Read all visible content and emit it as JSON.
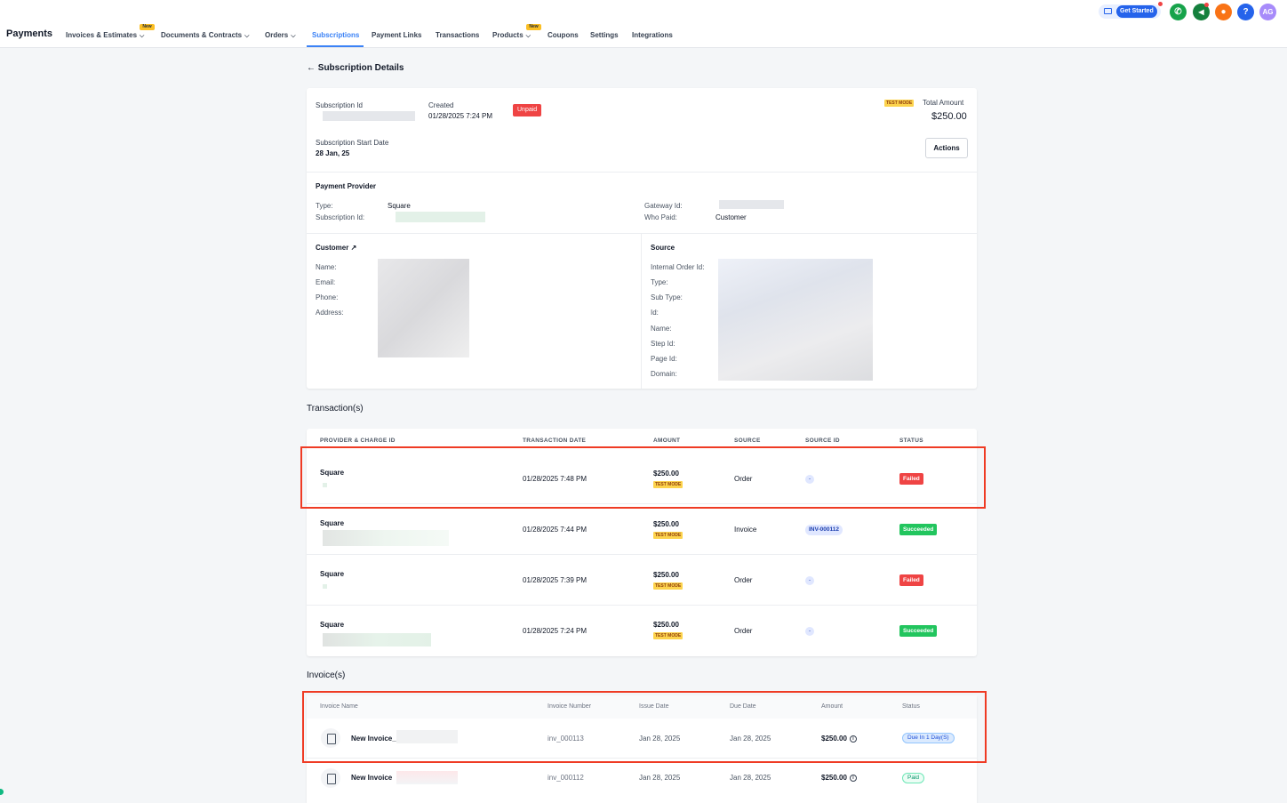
{
  "app": {
    "title": "Payments"
  },
  "nav": {
    "invoices": "Invoices & Estimates",
    "documents": "Documents & Contracts",
    "orders": "Orders",
    "subscriptions": "Subscriptions",
    "payment_links": "Payment Links",
    "transactions": "Transactions",
    "products": "Products",
    "coupons": "Coupons",
    "settings": "Settings",
    "integrations": "Integrations",
    "new_badge": "New"
  },
  "header_actions": {
    "get_started": "Get Started",
    "help": "?",
    "avatar": "AG"
  },
  "page": {
    "back_title": "Subscription Details"
  },
  "summary": {
    "subscription_id_label": "Subscription Id",
    "created_label": "Created",
    "created_value": "01/28/2025 7:24 PM",
    "status": "Unpaid",
    "test_mode": "TEST MODE",
    "total_label": "Total Amount",
    "total_value": "$250.00",
    "start_label": "Subscription Start Date",
    "start_value": "28 Jan, 25",
    "actions_button": "Actions"
  },
  "provider": {
    "title": "Payment Provider",
    "type_label": "Type:",
    "type_value": "Square",
    "sub_id_label": "Subscription Id:",
    "gateway_label": "Gateway Id:",
    "who_paid_label": "Who Paid:",
    "who_paid_value": "Customer"
  },
  "customer": {
    "title": "Customer",
    "name_label": "Name:",
    "email_label": "Email:",
    "phone_label": "Phone:",
    "address_label": "Address:"
  },
  "source": {
    "title": "Source",
    "internal_label": "Internal Order Id:",
    "type_label": "Type:",
    "subtype_label": "Sub Type:",
    "id_label": "Id:",
    "name_label": "Name:",
    "step_label": "Step Id:",
    "page_label": "Page Id:",
    "domain_label": "Domain:"
  },
  "transactions": {
    "title": "Transaction(s)",
    "headers": [
      "PROVIDER & CHARGE ID",
      "TRANSACTION DATE",
      "AMOUNT",
      "SOURCE",
      "SOURCE ID",
      "STATUS"
    ],
    "test_mode": "TEST MODE",
    "rows": [
      {
        "provider": "Square",
        "date": "01/28/2025 7:48 PM",
        "amount": "$250.00",
        "source": "Order",
        "source_id": "-",
        "status": "Failed"
      },
      {
        "provider": "Square",
        "date": "01/28/2025 7:44 PM",
        "amount": "$250.00",
        "source": "Invoice",
        "source_id": "INV-000112",
        "status": "Succeeded"
      },
      {
        "provider": "Square",
        "date": "01/28/2025 7:39 PM",
        "amount": "$250.00",
        "source": "Order",
        "source_id": "-",
        "status": "Failed"
      },
      {
        "provider": "Square",
        "date": "01/28/2025 7:24 PM",
        "amount": "$250.00",
        "source": "Order",
        "source_id": "-",
        "status": "Succeeded"
      }
    ]
  },
  "invoices": {
    "title": "Invoice(s)",
    "headers": [
      "Invoice Name",
      "Invoice Number",
      "Issue Date",
      "Due Date",
      "Amount",
      "Status"
    ],
    "rows": [
      {
        "name": "New Invoice_",
        "number": "inv_000113",
        "issue": "Jan 28, 2025",
        "due": "Jan 28, 2025",
        "amount": "$250.00",
        "status": "Due In 1 Day(S)"
      },
      {
        "name": "New Invoice",
        "number": "inv_000112",
        "issue": "Jan 28, 2025",
        "due": "Jan 28, 2025",
        "amount": "$250.00",
        "status": "Paid"
      }
    ]
  },
  "colors": {
    "accent": "#3b82f6",
    "failed": "#ef4444",
    "succeeded": "#22c55e",
    "highlight_box": "#ef3b24"
  }
}
